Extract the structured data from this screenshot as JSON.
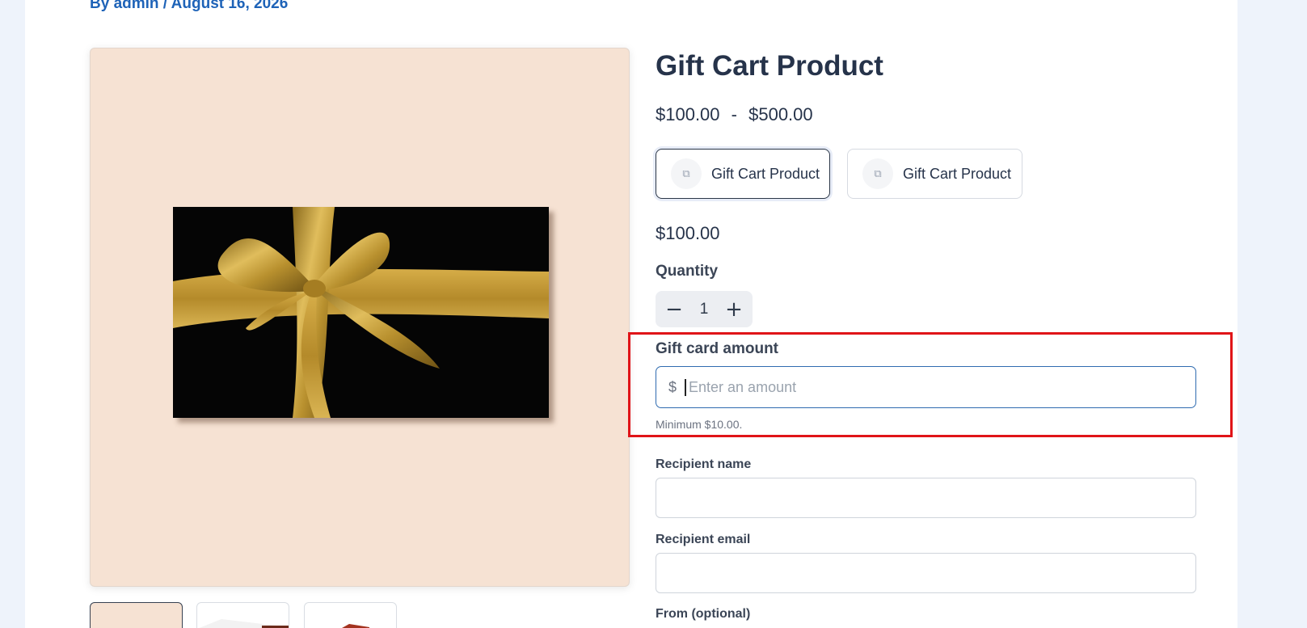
{
  "byline": {
    "prefix": "By admin / August 16, 2026"
  },
  "product": {
    "title": "Gift Cart Product",
    "price_range_min": "$100.00",
    "price_range_sep": "-",
    "price_range_max": "$500.00",
    "price": "$100.00"
  },
  "variants": [
    {
      "label": "Gift Cart Product",
      "icon": "image-icon",
      "selected": true
    },
    {
      "label": "Gift Cart Product",
      "icon": "image-icon",
      "selected": false
    }
  ],
  "quantity": {
    "label": "Quantity",
    "value": "1",
    "decrement": "−",
    "increment": "+"
  },
  "gift_card": {
    "label": "Gift card amount",
    "currency": "$",
    "placeholder": "Enter an amount",
    "hint": "Minimum $10.00."
  },
  "form": {
    "recipient_name_label": "Recipient name",
    "recipient_email_label": "Recipient email",
    "from_label": "From (optional)"
  },
  "colors": {
    "accent_link": "#1e63b8",
    "highlight_border": "#e01418",
    "image_background": "#f6e2d3",
    "ribbon_gold": "#c9a13a"
  }
}
